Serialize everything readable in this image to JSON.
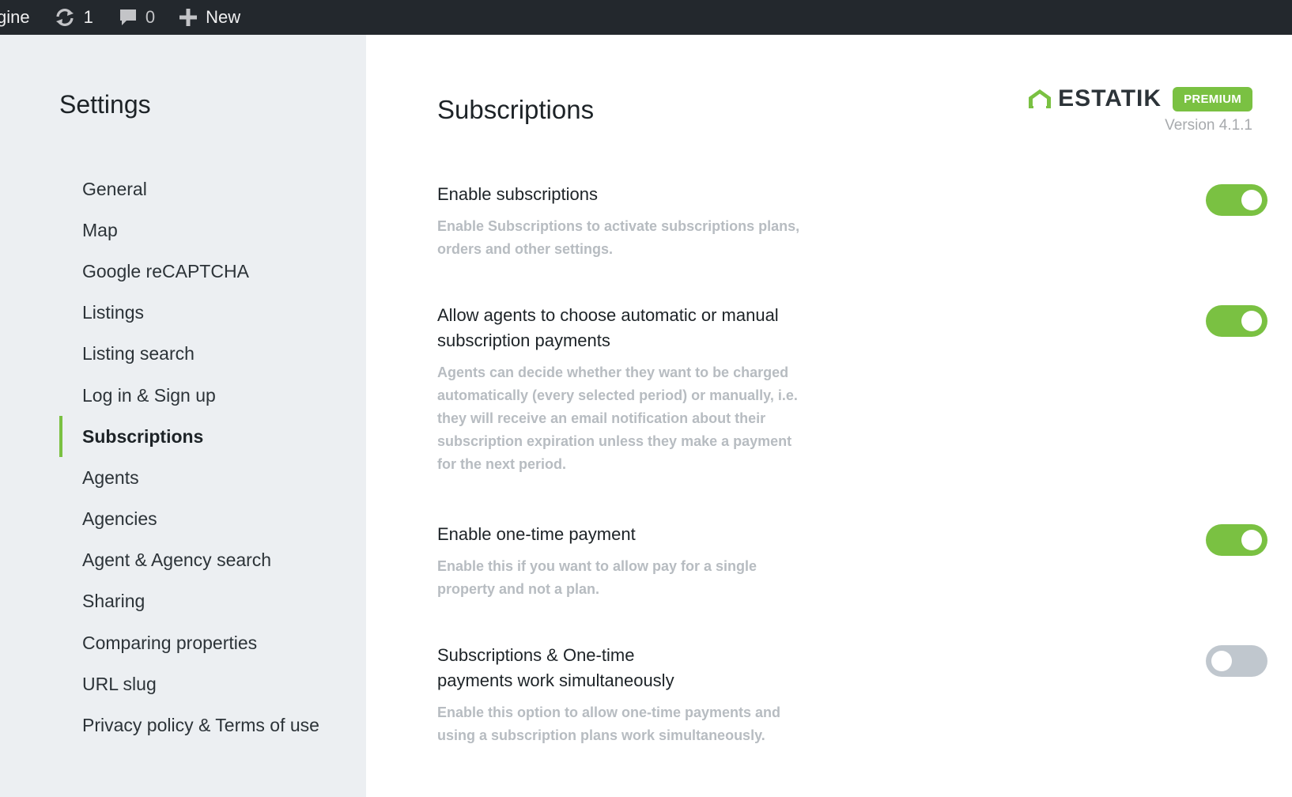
{
  "adminbar": {
    "site_name": "gine",
    "updates_count": "1",
    "comments_count": "0",
    "new_label": "New",
    "icons": {
      "updates": "refresh-icon",
      "comments": "comment-bubble-icon",
      "new": "plus-icon"
    }
  },
  "sidebar": {
    "title": "Settings",
    "active_item": "Subscriptions",
    "items": [
      {
        "label": "General"
      },
      {
        "label": "Map"
      },
      {
        "label": "Google reCAPTCHA"
      },
      {
        "label": "Listings"
      },
      {
        "label": "Listing search"
      },
      {
        "label": "Log in & Sign up"
      },
      {
        "label": "Subscriptions"
      },
      {
        "label": "Agents"
      },
      {
        "label": "Agencies"
      },
      {
        "label": "Agent & Agency search"
      },
      {
        "label": "Sharing"
      },
      {
        "label": "Comparing properties"
      },
      {
        "label": "URL slug"
      },
      {
        "label": "Privacy policy & Terms of use"
      }
    ]
  },
  "main": {
    "title": "Subscriptions",
    "brand": {
      "name": "ESTATIK",
      "badge": "PREMIUM",
      "version": "Version 4.1.1",
      "logo_icon": "house-outline-icon"
    },
    "settings": [
      {
        "title": "Enable subscriptions",
        "description": "Enable Subscriptions to activate subscriptions plans, orders and other settings.",
        "enabled": true
      },
      {
        "title": "Allow agents to choose automatic or manual subscription payments",
        "description": "Agents can decide whether they want to be charged automatically (every selected period) or manually, i.e. they will receive an email notification about their subscription expiration unless they make a payment for the next period.",
        "enabled": true
      },
      {
        "title": "Enable one-time payment",
        "description": "Enable this if you want to allow pay for a single property and not a plan.",
        "enabled": true
      },
      {
        "title": "Subscriptions & One-time payments work simultaneously",
        "description": "Enable this option to allow one-time payments and using a subscription plans work simultaneously.",
        "enabled": false
      }
    ]
  },
  "colors": {
    "accent": "#7ac142",
    "adminbar_bg": "#23282d",
    "sidebar_bg": "#eceff2",
    "toggle_off": "#c0c7ce",
    "description_text": "#b7bcc1"
  }
}
